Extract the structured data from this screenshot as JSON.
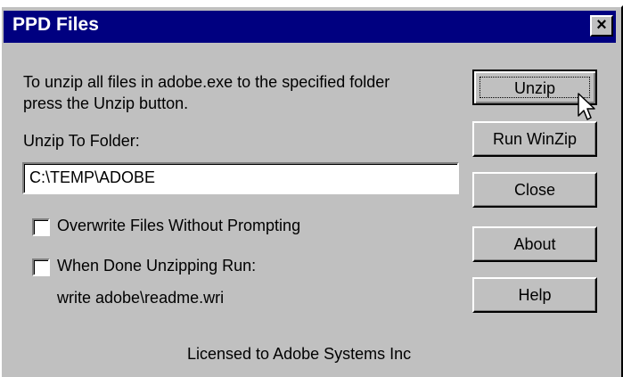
{
  "window": {
    "title": "PPD Files",
    "close_glyph": "×"
  },
  "instructions": {
    "line1": "To unzip all files in adobe.exe to the specified folder",
    "line2": "press the Unzip button."
  },
  "folder": {
    "label": "Unzip To Folder:",
    "value": "C:\\TEMP\\ADOBE"
  },
  "options": {
    "overwrite_label": "Overwrite Files Without Prompting",
    "overwrite_checked": false,
    "run_label": "When Done Unzipping Run:",
    "run_checked": false,
    "run_command": "write adobe\\readme.wri"
  },
  "footer": {
    "license": "Licensed to Adobe Systems Inc"
  },
  "buttons": {
    "unzip": "Unzip",
    "run_winzip": "Run WinZip",
    "close": "Close",
    "about": "About",
    "help": "Help"
  },
  "colors": {
    "titlebar": "#000080",
    "face": "#c0c0c0"
  }
}
